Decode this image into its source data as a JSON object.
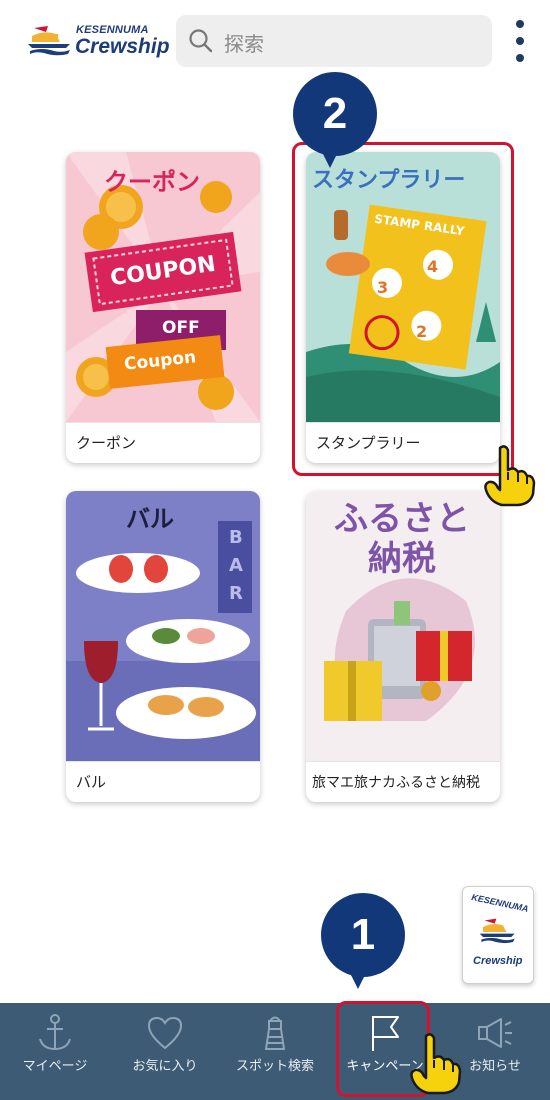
{
  "header": {
    "logo_line1": "KESENNUMA",
    "logo_line2": "Crewship",
    "search_placeholder": "探索",
    "icons": [
      "search-icon",
      "kebab-menu-icon"
    ]
  },
  "cards": [
    {
      "label": "クーポン",
      "title_art": "クーポン",
      "art_words": [
        "COUPON",
        "OFF",
        "Coupon"
      ]
    },
    {
      "label": "スタンプラリー",
      "title_art": "スタンプラリー",
      "art_words": [
        "STAMP RALLY",
        "4",
        "3",
        "2"
      ]
    },
    {
      "label": "バル",
      "title_art": "バル",
      "art_words": [
        "B",
        "A",
        "R"
      ]
    },
    {
      "label": "旅マエ旅ナカふるさと納税",
      "title_art": "ふるさと納税",
      "art_words": []
    }
  ],
  "annotations": {
    "step1": "1",
    "step2": "2",
    "highlight_color": "#d2122e",
    "badge_color": "#13387a"
  },
  "floating_logo": {
    "line1": "KESENNUMA",
    "line2": "Crewship"
  },
  "nav": {
    "background": "#3d5b74",
    "items": [
      {
        "label": "マイページ",
        "icon": "anchor-icon"
      },
      {
        "label": "お気に入り",
        "icon": "heart-icon"
      },
      {
        "label": "スポット検索",
        "icon": "lighthouse-icon"
      },
      {
        "label": "キャンペーン",
        "icon": "flag-icon"
      },
      {
        "label": "お知らせ",
        "icon": "megaphone-icon"
      }
    ]
  }
}
